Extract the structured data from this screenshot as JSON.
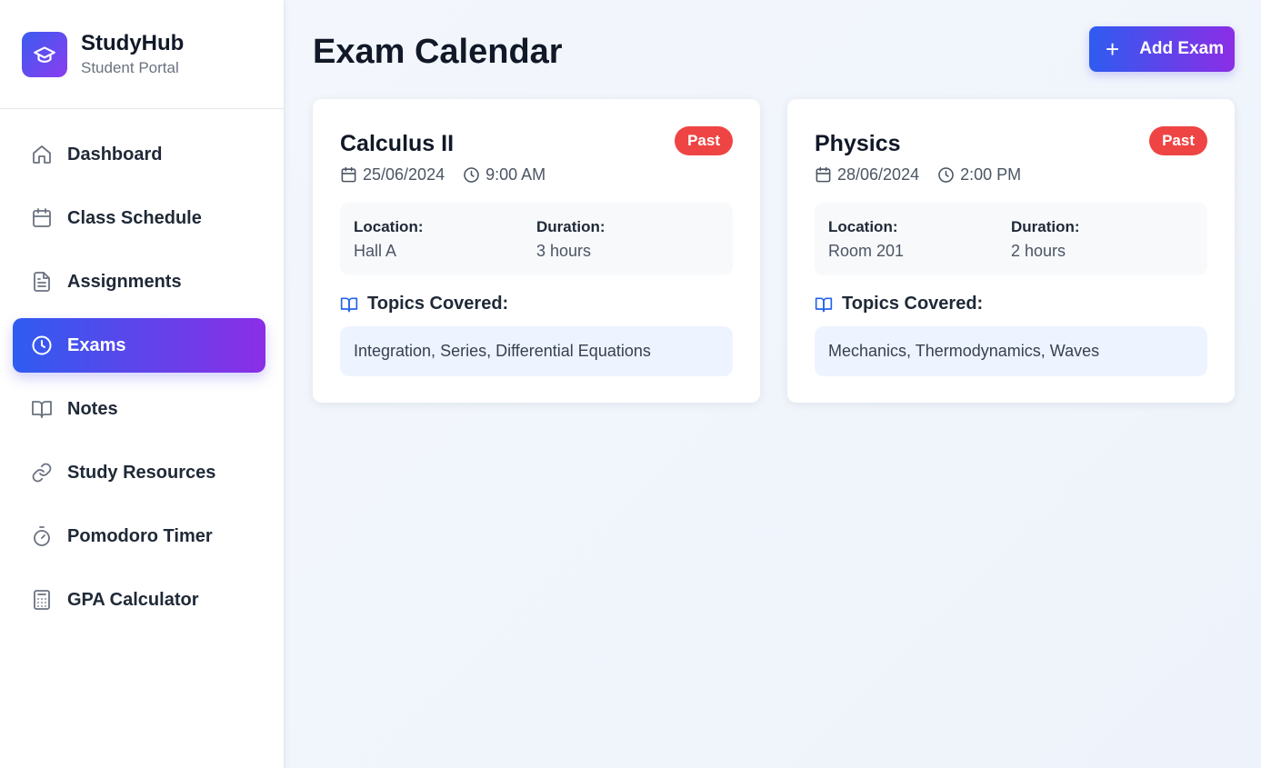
{
  "brand": {
    "name": "StudyHub",
    "subtitle": "Student Portal",
    "icon": "graduation-cap-icon"
  },
  "sidebar": {
    "items": [
      {
        "label": "Dashboard",
        "icon": "home-icon",
        "active": false
      },
      {
        "label": "Class Schedule",
        "icon": "calendar-icon",
        "active": false
      },
      {
        "label": "Assignments",
        "icon": "document-icon",
        "active": false
      },
      {
        "label": "Exams",
        "icon": "clock-icon",
        "active": true
      },
      {
        "label": "Notes",
        "icon": "book-icon",
        "active": false
      },
      {
        "label": "Study Resources",
        "icon": "link-icon",
        "active": false
      },
      {
        "label": "Pomodoro Timer",
        "icon": "timer-icon",
        "active": false
      },
      {
        "label": "GPA Calculator",
        "icon": "calculator-icon",
        "active": false
      }
    ]
  },
  "main": {
    "title": "Exam Calendar",
    "add_button_label": "Add Exam",
    "exams": [
      {
        "subject": "Calculus II",
        "status": "Past",
        "date": "25/06/2024",
        "time": "9:00 AM",
        "location_label": "Location:",
        "location": "Hall A",
        "duration_label": "Duration:",
        "duration": "3 hours",
        "topics_label": "Topics Covered:",
        "topics": "Integration, Series, Differential Equations"
      },
      {
        "subject": "Physics",
        "status": "Past",
        "date": "28/06/2024",
        "time": "2:00 PM",
        "location_label": "Location:",
        "location": "Room 201",
        "duration_label": "Duration:",
        "duration": "2 hours",
        "topics_label": "Topics Covered:",
        "topics": "Mechanics, Thermodynamics, Waves"
      }
    ]
  },
  "colors": {
    "accent_start": "#2f5cf0",
    "accent_end": "#8b2ee6",
    "status_past": "#ef4444",
    "topics_icon": "#2563eb"
  }
}
